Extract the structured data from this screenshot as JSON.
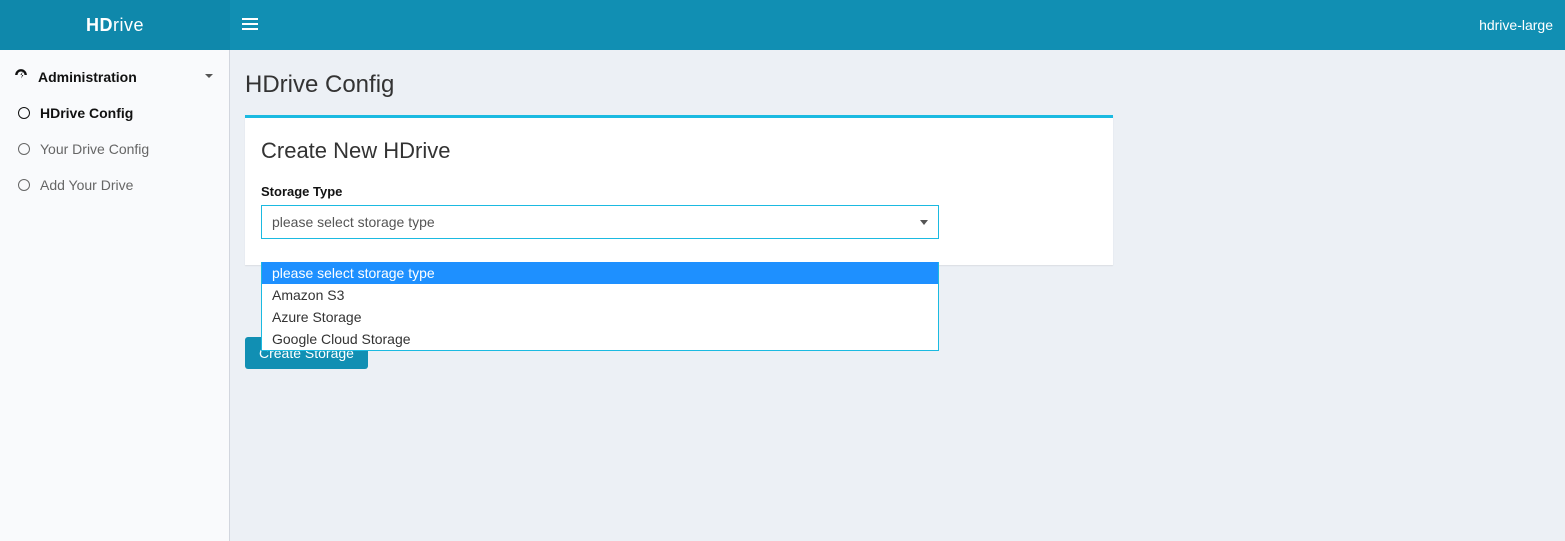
{
  "header": {
    "brand_bold": "HD",
    "brand_rest": "rive",
    "user_label": "hdrive-large"
  },
  "sidebar": {
    "section_label": "Administration",
    "items": [
      {
        "label": "HDrive Config",
        "active": true
      },
      {
        "label": "Your Drive Config",
        "active": false
      },
      {
        "label": "Add Your Drive",
        "active": false
      }
    ]
  },
  "page": {
    "title": "HDrive Config",
    "panel_title": "Create New HDrive",
    "field_label": "Storage Type",
    "select_placeholder": "please select storage type",
    "options": [
      "please select storage type",
      "Amazon S3",
      "Azure Storage",
      "Google Cloud Storage"
    ],
    "selected_option_index": 0,
    "submit_label": "Create Storage"
  },
  "colors": {
    "primary": "#118fb3",
    "accent": "#1bbae1",
    "highlight": "#1e90ff"
  }
}
